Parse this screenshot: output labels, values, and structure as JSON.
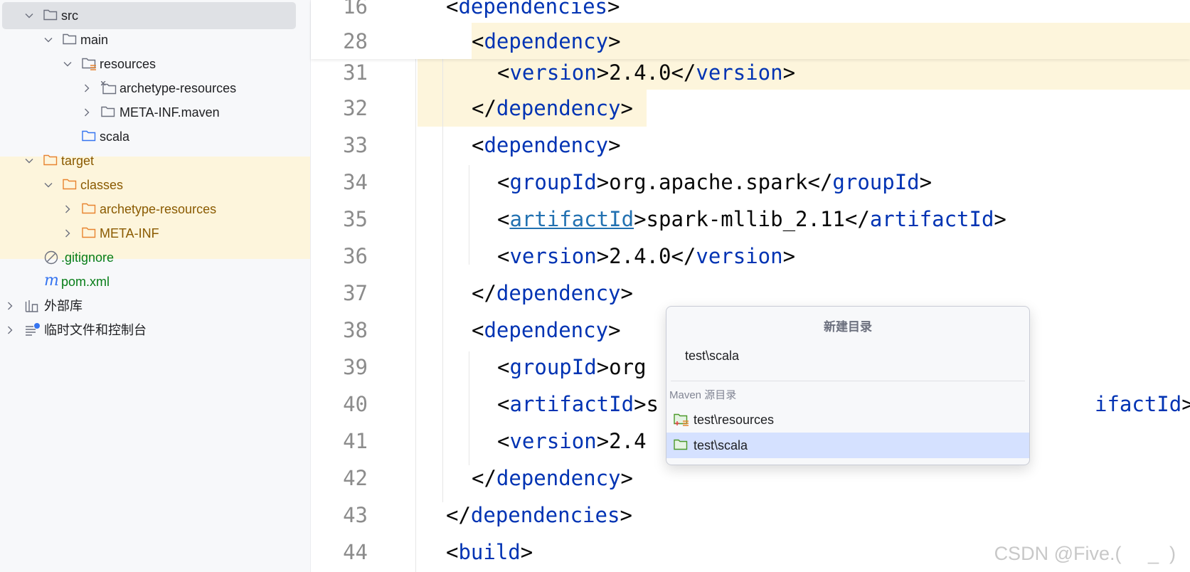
{
  "project_tree": {
    "items": [
      {
        "label": "src",
        "expanded": true,
        "icon": "folder-icon"
      },
      {
        "label": "main",
        "expanded": true,
        "icon": "folder-icon"
      },
      {
        "label": "resources",
        "expanded": true,
        "icon": "resources-folder-icon"
      },
      {
        "label": "archetype-resources",
        "expanded": false,
        "icon": "excluded-folder-icon"
      },
      {
        "label": "META-INF.maven",
        "expanded": false,
        "icon": "folder-icon"
      },
      {
        "label": "scala",
        "icon": "source-folder-icon"
      },
      {
        "label": "target",
        "expanded": true,
        "icon": "excluded-folder-icon"
      },
      {
        "label": "classes",
        "expanded": true,
        "icon": "excluded-folder-icon"
      },
      {
        "label": "archetype-resources",
        "expanded": false,
        "icon": "excluded-folder-icon"
      },
      {
        "label": "META-INF",
        "expanded": false,
        "icon": "excluded-folder-icon"
      },
      {
        "label": ".gitignore",
        "icon": "gitignore-icon"
      },
      {
        "label": "pom.xml",
        "icon": "maven-icon"
      },
      {
        "label": "外部库",
        "expanded": false,
        "icon": "library-icon"
      },
      {
        "label": "临时文件和控制台",
        "expanded": false,
        "icon": "scratches-icon"
      }
    ]
  },
  "editor": {
    "sticky_lines": [
      {
        "num": "16",
        "pre": "",
        "tag_open": "<",
        "tag": "dependencies",
        "tag_close": ">"
      },
      {
        "num": "28",
        "pre": "  ",
        "tag_open": "<",
        "tag": "dependency",
        "tag_close": ">"
      }
    ],
    "lines": [
      {
        "num": "31",
        "text_a": "<",
        "tag1": "version",
        "mid": ">2.4.0</",
        "tag2": "version",
        "end": ">"
      },
      {
        "num": "32",
        "text_a": "</",
        "tag1": "dependency",
        "mid": ">",
        "tag2": "",
        "end": ""
      },
      {
        "num": "33",
        "text_a": "<",
        "tag1": "dependency",
        "mid": ">",
        "tag2": "",
        "end": ""
      },
      {
        "num": "34",
        "text_a": "<",
        "tag1": "groupId",
        "mid": ">org.apache.spark</",
        "tag2": "groupId",
        "end": ">"
      },
      {
        "num": "35",
        "text_a": "<",
        "tag1": "artifactId",
        "mid": ">spark-mllib_2.11</",
        "tag2": "artifactId",
        "end": ">"
      },
      {
        "num": "36",
        "text_a": "<",
        "tag1": "version",
        "mid": ">2.4.0</",
        "tag2": "version",
        "end": ">"
      },
      {
        "num": "37",
        "text_a": "</",
        "tag1": "dependency",
        "mid": ">",
        "tag2": "",
        "end": ""
      },
      {
        "num": "38",
        "text_a": "<",
        "tag1": "dependency",
        "mid": ">",
        "tag2": "",
        "end": ""
      },
      {
        "num": "39",
        "text_a": "<",
        "tag1": "groupId",
        "mid": ">org",
        "tag2": "",
        "end": ""
      },
      {
        "num": "40",
        "text_a": "<",
        "tag1": "artifactId",
        "mid": ">s",
        "tag2": "ifactId",
        "end": ">"
      },
      {
        "num": "41",
        "text_a": "<",
        "tag1": "version",
        "mid": ">2.4",
        "tag2": "",
        "end": ""
      },
      {
        "num": "42",
        "text_a": "</",
        "tag1": "dependency",
        "mid": ">",
        "tag2": "",
        "end": ""
      },
      {
        "num": "43",
        "text_a": "</",
        "tag1": "dependencies",
        "mid": ">",
        "tag2": "",
        "end": ""
      },
      {
        "num": "44",
        "text_a": "<",
        "tag1": "build",
        "mid": ">",
        "tag2": "",
        "end": ""
      }
    ]
  },
  "popup": {
    "title": "新建目录",
    "input_value": "test\\scala",
    "section_label": "Maven 源目录",
    "items": [
      {
        "label": "test\\resources",
        "icon": "test-resources-folder-icon",
        "selected": false
      },
      {
        "label": "test\\scala",
        "icon": "test-source-folder-icon",
        "selected": true
      }
    ]
  },
  "watermark": "CSDN @Five.(     _  )",
  "colors": {
    "tag": "#0033b3",
    "highlight": "#fdf5dc",
    "selection": "#d5e1ff",
    "excluded": "#8a5a00",
    "vcs_added": "#067d17"
  }
}
